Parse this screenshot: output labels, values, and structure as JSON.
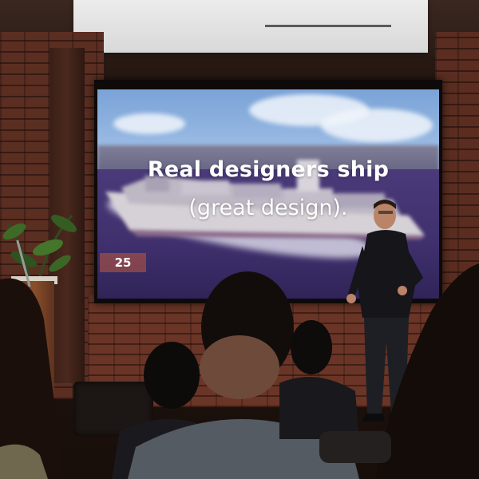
{
  "slide": {
    "title": "Real designers ship",
    "subtitle": "(great design).",
    "number": "25"
  },
  "colors": {
    "brick": "#5b2e22",
    "slide_sky": "#9bbbe3",
    "slide_sea": "#4b3a7a",
    "slide_text": "#ffffff",
    "slide_number_bg": "#be5a3c"
  },
  "scene": {
    "description_icons": [
      "projector-screen",
      "speaker-person",
      "audience-heads",
      "lectern",
      "plant"
    ]
  }
}
